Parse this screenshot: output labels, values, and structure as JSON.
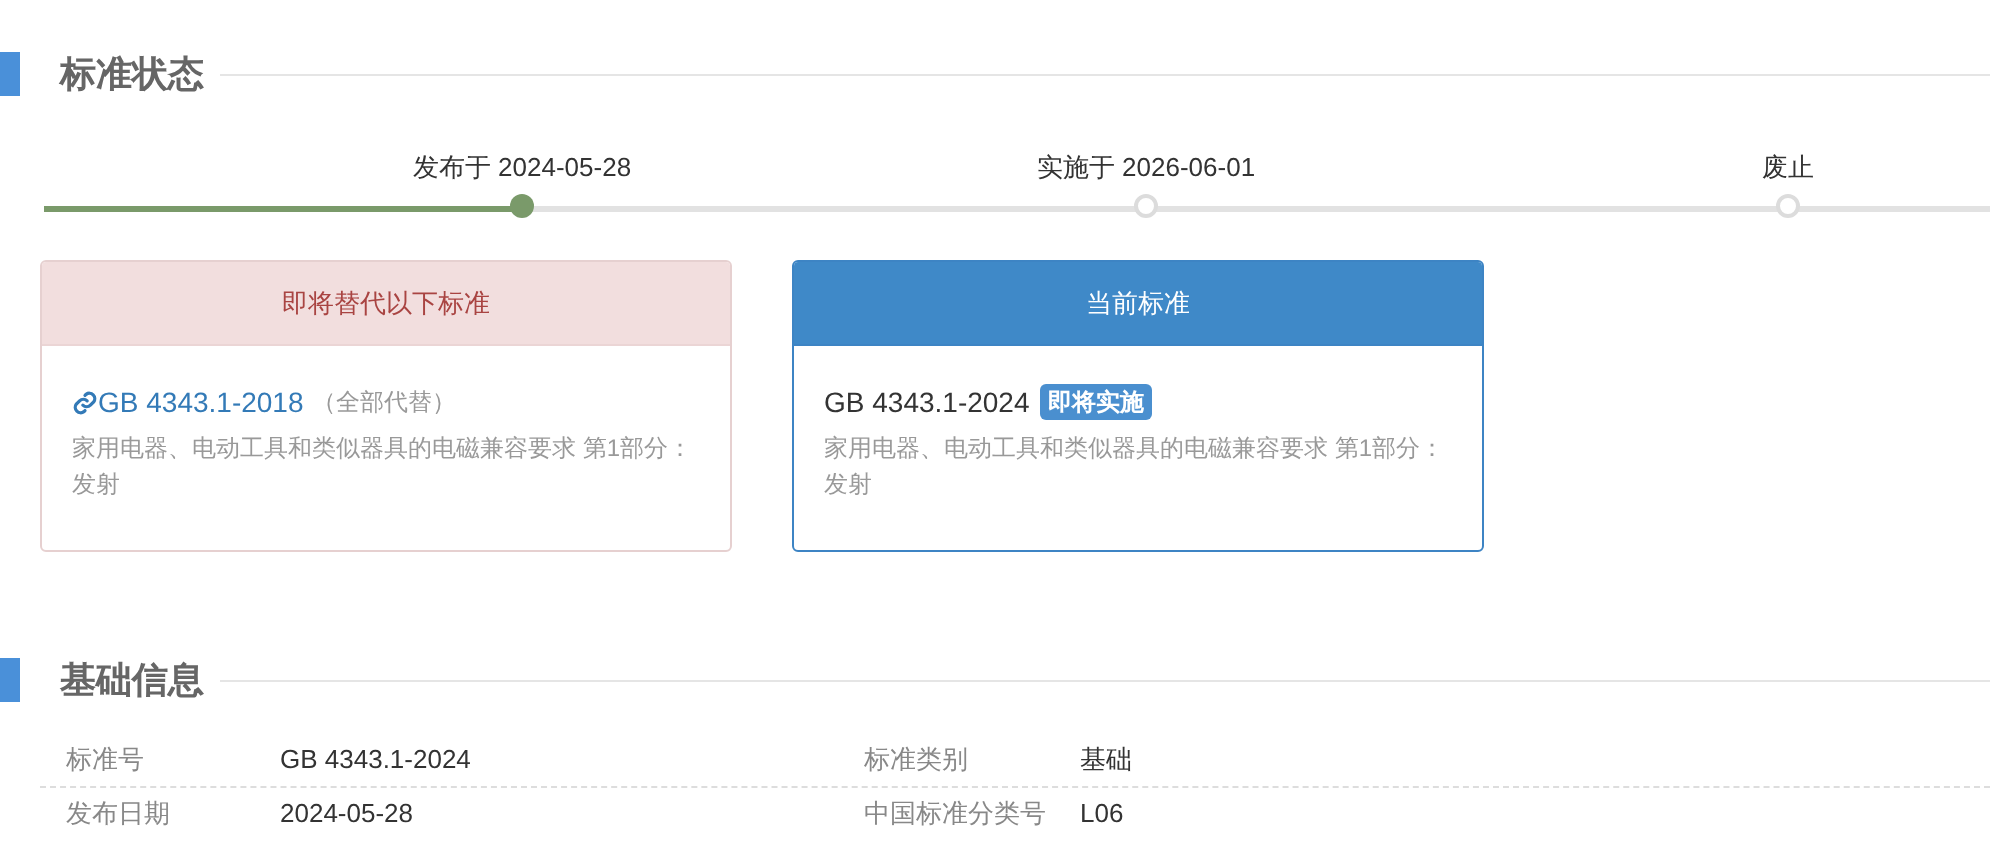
{
  "status_section": {
    "title": "标准状态"
  },
  "timeline": {
    "level": 0.246,
    "stops": [
      {
        "label": "发布于 2024-05-28",
        "reached": true
      },
      {
        "label": "实施于 2026-06-01",
        "reached": false
      },
      {
        "label": "废止",
        "reached": false
      }
    ]
  },
  "cards": [
    {
      "kind": "replaced",
      "header": "即将替代以下标准",
      "code": "GB 4343.1-2018",
      "note": "（全部代替）",
      "description": "家用电器、电动工具和类似器具的电磁兼容要求 第1部分：发射"
    },
    {
      "kind": "current",
      "header": "当前标准",
      "code": "GB 4343.1-2024",
      "badge": "即将实施",
      "description": "家用电器、电动工具和类似器具的电磁兼容要求 第1部分：发射"
    }
  ],
  "info_section": {
    "title": "基础信息"
  },
  "info_rows": [
    {
      "label": "标准号",
      "value": "GB 4343.1-2024",
      "label_2": "标准类别",
      "value_2": "基础"
    },
    {
      "label": "发布日期",
      "value": "2024-05-28",
      "label_2": "中国标准分类号",
      "value_2": "L06"
    }
  ]
}
